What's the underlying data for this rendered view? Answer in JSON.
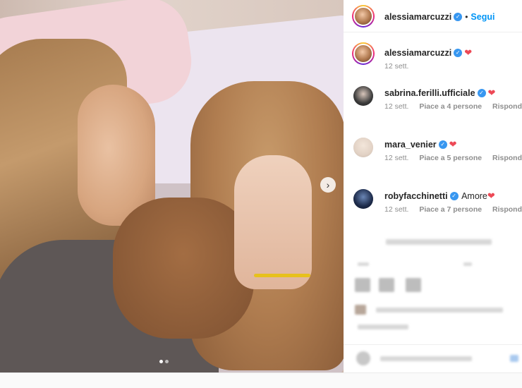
{
  "post": {
    "author": "alessiamarcuzzi",
    "follow_label": "Segui",
    "caption_date": "12 sett."
  },
  "comments": [
    {
      "username": "sabrina.ferilli.ufficiale",
      "text": "",
      "date": "12 sett.",
      "likes": "Piace a 4 persone",
      "reply": "Rispondi"
    },
    {
      "username": "mara_venier",
      "text": "",
      "date": "12 sett.",
      "likes": "Piace a 5 persone",
      "reply": "Rispondi"
    },
    {
      "username": "robyfacchinetti",
      "text": "Amore",
      "date": "12 sett.",
      "likes": "Piace a 7 persone",
      "reply": "Rispondi"
    }
  ],
  "icons": {
    "verified": "verified-badge-icon",
    "heart": "red-heart-emoji",
    "next": "chevron-right-icon"
  },
  "colors": {
    "link": "#0095f6",
    "verified": "#3897f0",
    "heart": "#ed4956"
  }
}
